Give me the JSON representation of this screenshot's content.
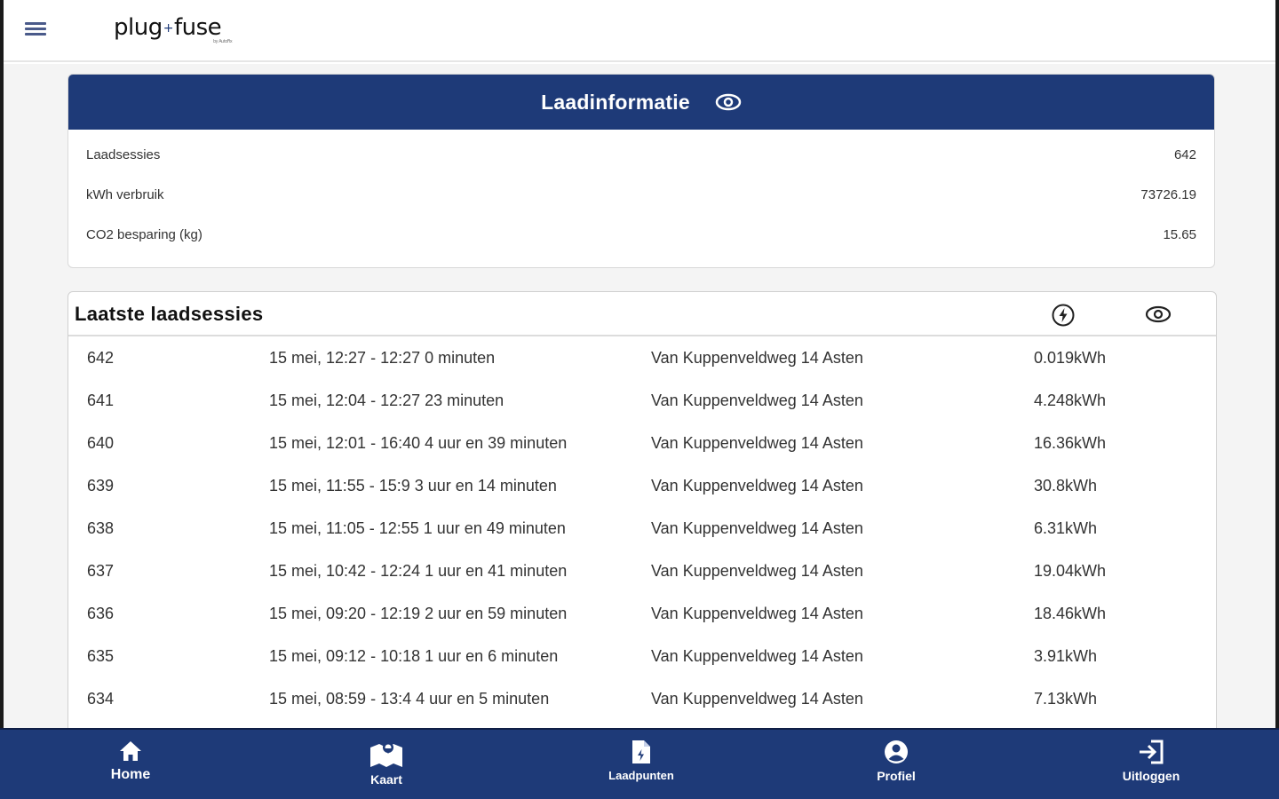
{
  "header": {
    "logo_left": "plug",
    "logo_right": "fuse",
    "logo_tag": "by AutoFix"
  },
  "info": {
    "title": "Laadinformatie",
    "rows": [
      {
        "label": "Laadsessies",
        "value": "642"
      },
      {
        "label": "kWh verbruik",
        "value": "73726.19"
      },
      {
        "label": "CO2 besparing (kg)",
        "value": "15.65"
      }
    ]
  },
  "sessions": {
    "title": "Laatste laadsessies",
    "rows": [
      {
        "id": "642",
        "time": "15 mei, 12:27 - 12:27 0 minuten",
        "address": "Van Kuppenveldweg 14 Asten",
        "kwh": "0.019kWh"
      },
      {
        "id": "641",
        "time": "15 mei, 12:04 - 12:27 23 minuten",
        "address": "Van Kuppenveldweg 14 Asten",
        "kwh": "4.248kWh"
      },
      {
        "id": "640",
        "time": "15 mei, 12:01 - 16:40 4 uur en 39 minuten",
        "address": "Van Kuppenveldweg 14 Asten",
        "kwh": "16.36kWh"
      },
      {
        "id": "639",
        "time": "15 mei, 11:55 - 15:9 3 uur en 14 minuten",
        "address": "Van Kuppenveldweg 14 Asten",
        "kwh": "30.8kWh"
      },
      {
        "id": "638",
        "time": "15 mei, 11:05 - 12:55 1 uur en 49 minuten",
        "address": "Van Kuppenveldweg 14 Asten",
        "kwh": "6.31kWh"
      },
      {
        "id": "637",
        "time": "15 mei, 10:42 - 12:24 1 uur en 41 minuten",
        "address": "Van Kuppenveldweg 14 Asten",
        "kwh": "19.04kWh"
      },
      {
        "id": "636",
        "time": "15 mei, 09:20 - 12:19 2 uur en 59 minuten",
        "address": "Van Kuppenveldweg 14 Asten",
        "kwh": "18.46kWh"
      },
      {
        "id": "635",
        "time": "15 mei, 09:12 - 10:18 1 uur en 6 minuten",
        "address": "Van Kuppenveldweg 14 Asten",
        "kwh": "3.91kWh"
      },
      {
        "id": "634",
        "time": "15 mei, 08:59 - 13:4 4 uur en 5 minuten",
        "address": "Van Kuppenveldweg 14 Asten",
        "kwh": "7.13kWh"
      }
    ]
  },
  "nav": {
    "items": [
      {
        "label": "Home",
        "icon": "home-icon"
      },
      {
        "label": "Kaart",
        "icon": "map-icon"
      },
      {
        "label": "Laadpunten",
        "icon": "document-icon"
      },
      {
        "label": "Profiel",
        "icon": "profile-icon"
      },
      {
        "label": "Uitloggen",
        "icon": "logout-icon"
      }
    ]
  },
  "colors": {
    "primary": "#1e3a78",
    "background": "#f4f4f4"
  }
}
